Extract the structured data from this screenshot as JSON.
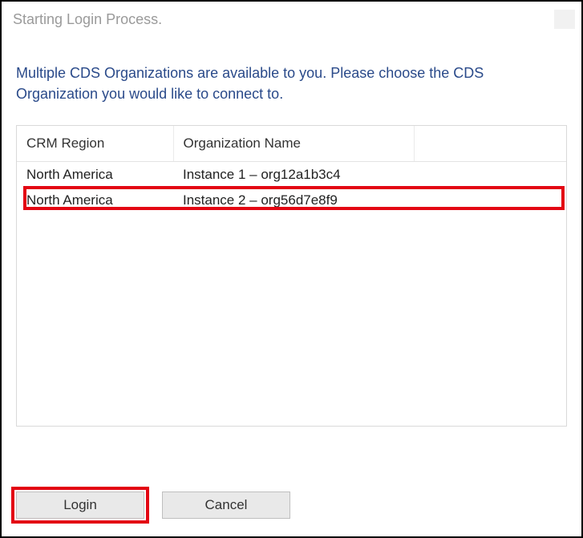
{
  "titlebar": {
    "title": "Starting Login Process.",
    "close_glyph": "×"
  },
  "instructions": "Multiple CDS Organizations are available to you. Please choose the CDS Organization you would like to connect to.",
  "table": {
    "headers": {
      "region": "CRM Region",
      "org": "Organization Name",
      "blank": ""
    },
    "rows": [
      {
        "region": "North America",
        "org": "Instance 1 – org12a1b3c4"
      },
      {
        "region": "North America",
        "org": "Instance 2 – org56d7e8f9"
      }
    ]
  },
  "buttons": {
    "login": "Login",
    "cancel": "Cancel"
  }
}
